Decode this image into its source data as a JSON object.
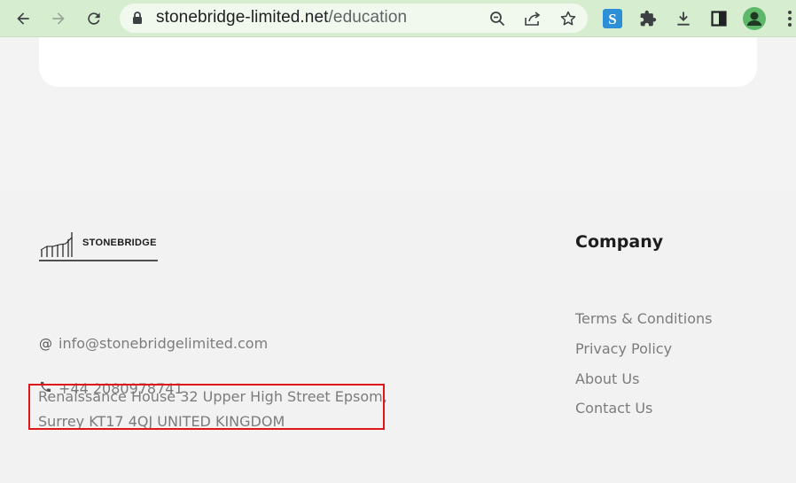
{
  "browser": {
    "url_host": "stonebridge-limited.net",
    "url_path": "/education",
    "icons": [
      "back-arrow-icon",
      "forward-arrow-icon",
      "reload-icon",
      "lock-icon",
      "zoom-icon",
      "share-icon",
      "star-icon",
      "extension-s-icon",
      "puzzle-icon",
      "download-icon",
      "side-panel-icon",
      "profile-icon",
      "menu-icon"
    ]
  },
  "footer": {
    "logo_text": "STONEBRIDGE",
    "email_icon": "@",
    "email": "info@stonebridgelimited.com",
    "phone": "+44 2080978741",
    "address_line1": "Renaissance House 32 Upper High Street Epsom,",
    "address_line2": "Surrey KT17 4QJ UNITED KINGDOM",
    "company_title": "Company",
    "links": [
      "Terms & Conditions",
      "Privacy Policy",
      "About Us",
      "Contact Us"
    ]
  },
  "colors": {
    "toolbar_bg": "#d7edd0",
    "highlight_border": "#e0161b",
    "text_muted": "#7c7c7c"
  }
}
